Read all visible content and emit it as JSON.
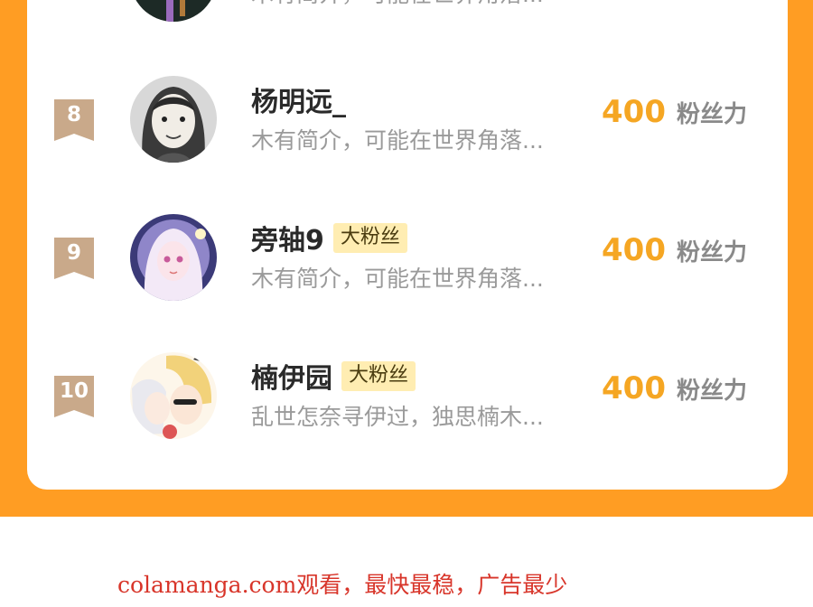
{
  "ranking": {
    "partial_top_row": {
      "bio": "木有简介，可能在世界角落..."
    },
    "rows": [
      {
        "rank": "8",
        "name": "杨明远_",
        "tag": "",
        "bio": "木有简介，可能在世界角落...",
        "score": "400",
        "score_unit": "粉丝力",
        "avatar_icon": "sketch-portrait-avatar"
      },
      {
        "rank": "9",
        "name": "旁轴9",
        "tag": "大粉丝",
        "bio": "木有简介，可能在世界角落...",
        "score": "400",
        "score_unit": "粉丝力",
        "avatar_icon": "anime-girl-avatar"
      },
      {
        "rank": "10",
        "name": "楠伊园",
        "tag": "大粉丝",
        "bio": "乱世怎奈寻伊过，独思楠木...",
        "score": "400",
        "score_unit": "粉丝力",
        "avatar_icon": "anime-duo-avatar"
      }
    ]
  },
  "footer": {
    "watermark": "colamanga.com观看，最快最稳，广告最少"
  },
  "colors": {
    "panel_orange": "#ff9d23",
    "score_yellow": "#f5a623",
    "rank_badge": "#c9a98a",
    "tag_background": "#ffedb2",
    "watermark_red": "#d8352a"
  }
}
